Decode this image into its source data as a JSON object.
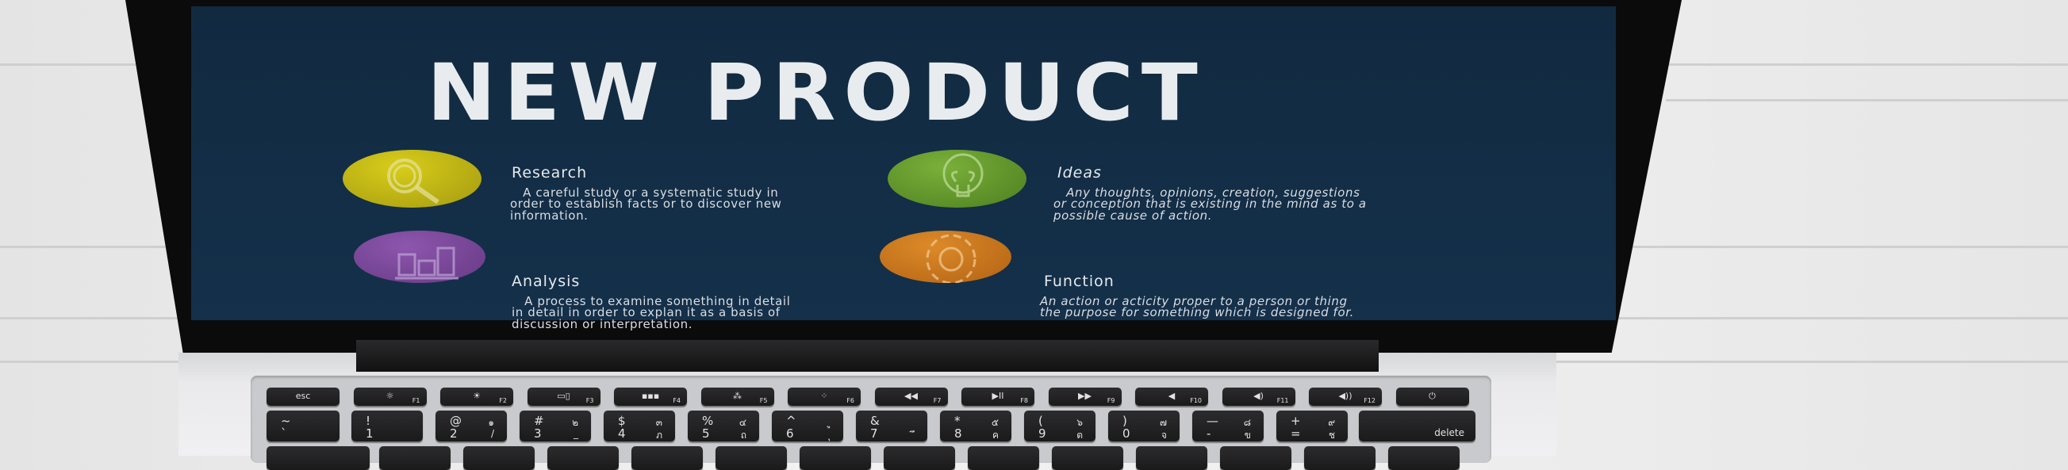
{
  "slide": {
    "title": "NEW PRODUCT",
    "items": [
      {
        "icon": "magnifier-icon",
        "color": "#c8bd12",
        "heading": "Research",
        "description": "   A careful study or a systematic study in\norder to establish facts or to discover new\ninformation."
      },
      {
        "icon": "bar-chart-icon",
        "color": "#7d4a9c",
        "heading": "Analysis",
        "description": "   A process to examine something in detail\nin detail in order to explan it as a basis of\ndiscussion or interpretation."
      },
      {
        "icon": "lightbulb-icon",
        "color": "#6a9a2c",
        "heading": "Ideas",
        "description": "   Any thoughts, opinions, creation, suggestions\nor conception that is existing in the mind as to a\npossible cause of action."
      },
      {
        "icon": "gear-icon",
        "color": "#d07a1e",
        "heading": "Function",
        "description": "An action or acticity proper to a person or thing\nthe purpose for something which is designed for."
      }
    ]
  },
  "keyboard": {
    "fn_row": [
      {
        "main": "esc",
        "sub": ""
      },
      {
        "main": "☼",
        "sub": "F1"
      },
      {
        "main": "☀",
        "sub": "F2"
      },
      {
        "main": "▭▯",
        "sub": "F3"
      },
      {
        "main": "▪▪▪",
        "sub": "F4"
      },
      {
        "main": "⁂",
        "sub": "F5"
      },
      {
        "main": "⁘",
        "sub": "F6"
      },
      {
        "main": "◀◀",
        "sub": "F7"
      },
      {
        "main": "▶II",
        "sub": "F8"
      },
      {
        "main": "▶▶",
        "sub": "F9"
      },
      {
        "main": "◀",
        "sub": "F10"
      },
      {
        "main": "◀)",
        "sub": "F11"
      },
      {
        "main": "◀))",
        "sub": "F12"
      },
      {
        "main": "⏻",
        "sub": ""
      }
    ],
    "number_row": [
      {
        "top": "~",
        "bottom": "`",
        "thai_top": "",
        "thai_bottom": ""
      },
      {
        "top": "!",
        "bottom": "1",
        "thai_top": "",
        "thai_bottom": ""
      },
      {
        "top": "@",
        "bottom": "2",
        "thai_top": "๑",
        "thai_bottom": "/"
      },
      {
        "top": "#",
        "bottom": "3",
        "thai_top": "๒",
        "thai_bottom": "_"
      },
      {
        "top": "$",
        "bottom": "4",
        "thai_top": "๓",
        "thai_bottom": "ภ"
      },
      {
        "top": "%",
        "bottom": "5",
        "thai_top": "๔",
        "thai_bottom": "ถ"
      },
      {
        "top": "^",
        "bottom": "6",
        "thai_top": "ู",
        "thai_bottom": "ุ"
      },
      {
        "top": "&",
        "bottom": "7",
        "thai_top": "",
        "thai_bottom": "ึ"
      },
      {
        "top": "*",
        "bottom": "8",
        "thai_top": "๕",
        "thai_bottom": "ค"
      },
      {
        "top": "(",
        "bottom": "9",
        "thai_top": "๖",
        "thai_bottom": "ต"
      },
      {
        "top": ")",
        "bottom": "0",
        "thai_top": "๗",
        "thai_bottom": "จ"
      },
      {
        "top": "—",
        "bottom": "-",
        "thai_top": "๘",
        "thai_bottom": "ข"
      },
      {
        "top": "+",
        "bottom": "=",
        "thai_top": "๙",
        "thai_bottom": "ช"
      }
    ],
    "delete_label": "delete"
  }
}
